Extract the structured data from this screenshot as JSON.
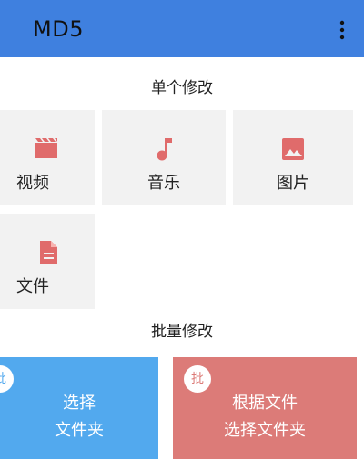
{
  "appbar": {
    "title": "MD5",
    "bar_color": "#3f80df",
    "menu_icon": "more-vert-icon"
  },
  "single_section": {
    "title": "单个修改",
    "items": [
      {
        "label": "视频",
        "icon": "movie-clapper-icon"
      },
      {
        "label": "音乐",
        "icon": "music-note-icon"
      },
      {
        "label": "图片",
        "icon": "image-icon"
      },
      {
        "label": "文件",
        "icon": "file-icon"
      }
    ],
    "tile_color": "#f2f2f2",
    "icon_color": "#e06b6b"
  },
  "batch_section": {
    "title": "批量修改",
    "cards": [
      {
        "line1": "选择",
        "line2": "文件夹",
        "badge": "批",
        "color": "#52a9ee"
      },
      {
        "line1": "根据文件",
        "line2": "选择文件夹",
        "badge": "批",
        "color": "#dc7b78"
      }
    ]
  }
}
